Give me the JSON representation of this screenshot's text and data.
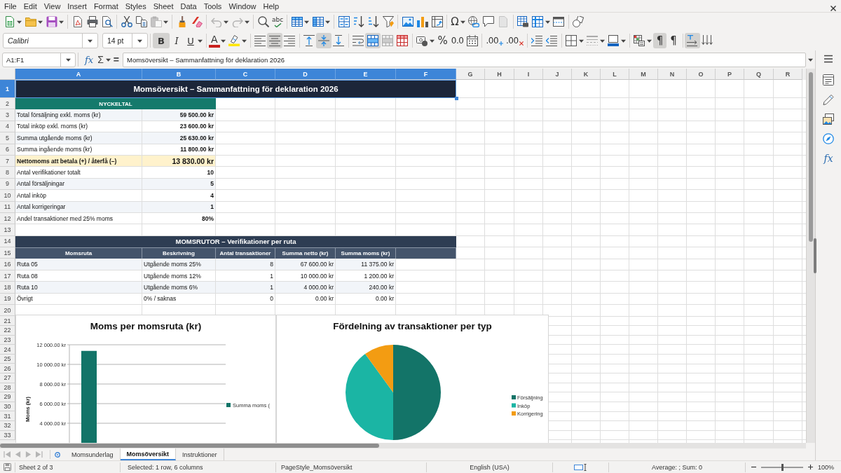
{
  "menu_bar": [
    "File",
    "Edit",
    "View",
    "Insert",
    "Format",
    "Styles",
    "Sheet",
    "Data",
    "Tools",
    "Window",
    "Help"
  ],
  "standard_toolbar": {
    "paste": {
      "disabled": true
    },
    "undo": {
      "disabled": true
    },
    "redo": {
      "disabled": true
    },
    "spelling": {
      "glyph": "abc"
    },
    "special_character": {
      "glyph": "Ω"
    }
  },
  "formatting_toolbar": {
    "font_name": "Calibri",
    "font_size": "14 pt",
    "bold": {
      "glyph": "B",
      "pressed": true
    },
    "italic": {
      "glyph": "I",
      "pressed": false
    },
    "underline": {
      "glyph": "U",
      "pressed": false
    },
    "font_color": {
      "glyph": "A"
    },
    "align_left": {
      "pressed": false
    },
    "align_center": {
      "pressed": true
    },
    "align_right": {
      "pressed": false
    },
    "align_top": {
      "pressed": false
    },
    "align_middle": {
      "pressed": true
    },
    "align_bottom": {
      "pressed": false
    },
    "merge_and_center": {
      "pressed": true
    },
    "percent": {
      "glyph": "%"
    },
    "number": {
      "glyph": "0.0"
    },
    "add_decimal": {
      "glyph": ".00"
    },
    "delete_decimal": {
      "glyph": ".00"
    },
    "left_to_right": {
      "glyph": "¶",
      "pressed": true
    },
    "right_to_left": {
      "glyph": "¶",
      "pressed": false
    },
    "text_direction": {
      "pressed": true
    }
  },
  "formula_bar": {
    "name_box": "A1:F1",
    "function_glyph": "fx",
    "sum_glyph": "Σ",
    "equals_glyph": "=",
    "content": "Momsöversikt – Sammanfattning för deklaration 2026"
  },
  "sidebar": {
    "functions_glyph": "fx"
  },
  "sheet": {
    "columns": [
      {
        "label": "A",
        "selected": true
      },
      {
        "label": "B",
        "selected": true
      },
      {
        "label": "C",
        "selected": true
      },
      {
        "label": "D",
        "selected": true
      },
      {
        "label": "E",
        "selected": true
      },
      {
        "label": "F",
        "selected": true
      },
      {
        "label": "G",
        "selected": false
      },
      {
        "label": "H",
        "selected": false
      },
      {
        "label": "I",
        "selected": false
      },
      {
        "label": "J",
        "selected": false
      },
      {
        "label": "K",
        "selected": false
      },
      {
        "label": "L",
        "selected": false
      },
      {
        "label": "M",
        "selected": false
      },
      {
        "label": "N",
        "selected": false
      },
      {
        "label": "O",
        "selected": false
      },
      {
        "label": "P",
        "selected": false
      },
      {
        "label": "Q",
        "selected": false
      },
      {
        "label": "R",
        "selected": false
      }
    ],
    "rows": [
      {
        "label": "1",
        "selected": true
      },
      {
        "label": "2",
        "selected": false
      },
      {
        "label": "3",
        "selected": false
      },
      {
        "label": "4",
        "selected": false
      },
      {
        "label": "5",
        "selected": false
      },
      {
        "label": "6",
        "selected": false
      },
      {
        "label": "7",
        "selected": false
      },
      {
        "label": "8",
        "selected": false
      },
      {
        "label": "9",
        "selected": false
      },
      {
        "label": "10",
        "selected": false
      },
      {
        "label": "11",
        "selected": false
      },
      {
        "label": "12",
        "selected": false
      },
      {
        "label": "13",
        "selected": false
      },
      {
        "label": "14",
        "selected": false
      },
      {
        "label": "15",
        "selected": false
      },
      {
        "label": "16",
        "selected": false
      },
      {
        "label": "17",
        "selected": false
      },
      {
        "label": "18",
        "selected": false
      },
      {
        "label": "19",
        "selected": false
      },
      {
        "label": "20",
        "selected": false
      },
      {
        "label": "21",
        "selected": false
      },
      {
        "label": "22",
        "selected": false
      },
      {
        "label": "23",
        "selected": false
      },
      {
        "label": "24",
        "selected": false
      },
      {
        "label": "25",
        "selected": false
      },
      {
        "label": "26",
        "selected": false
      },
      {
        "label": "27",
        "selected": false
      },
      {
        "label": "28",
        "selected": false
      },
      {
        "label": "29",
        "selected": false
      },
      {
        "label": "30",
        "selected": false
      },
      {
        "label": "31",
        "selected": false
      },
      {
        "label": "32",
        "selected": false
      },
      {
        "label": "33",
        "selected": false
      }
    ],
    "title": {
      "text": "Momsöversikt – Sammanfattning för deklaration 2026",
      "selected": true
    },
    "key_figures": {
      "heading": "NYCKELTAL",
      "items": [
        {
          "label": "Total försäljning exkl. moms (kr)",
          "value": "59 500.00 kr",
          "highlighted": false
        },
        {
          "label": "Total inköp exkl. moms (kr)",
          "value": "23 600.00 kr",
          "highlighted": false
        },
        {
          "label": "Summa utgående moms (kr)",
          "value": "25 630.00 kr",
          "highlighted": false
        },
        {
          "label": "Summa ingående moms (kr)",
          "value": "11 800.00 kr",
          "highlighted": false
        },
        {
          "label": "Nettomoms att betala (+) / återfå (–)",
          "value": "13 830.00 kr",
          "highlighted": true
        },
        {
          "label": "Antal verifikationer totalt",
          "value": "10",
          "highlighted": false
        },
        {
          "label": "Antal försäljningar",
          "value": "5",
          "highlighted": false
        },
        {
          "label": "Antal inköp",
          "value": "4",
          "highlighted": false
        },
        {
          "label": "Antal korrigeringar",
          "value": "1",
          "highlighted": false
        },
        {
          "label": "Andel transaktioner med 25% moms",
          "value": "80%",
          "highlighted": false
        }
      ]
    },
    "vat_boxes": {
      "heading": "MOMSRUTOR – Verifikationer per ruta",
      "columns": [
        "Momsruta",
        "Beskrivning",
        "Antal transaktioner",
        "Summa netto (kr)",
        "Summa moms (kr)"
      ],
      "rows": [
        [
          "Ruta 05",
          "Utgående moms 25%",
          "8",
          "67 600.00 kr",
          "11 375.00 kr"
        ],
        [
          "Ruta 08",
          "Utgående moms 12%",
          "1",
          "10 000.00 kr",
          "1 200.00 kr"
        ],
        [
          "Ruta 10",
          "Utgående moms 6%",
          "1",
          "4 000.00 kr",
          "240.00 kr"
        ],
        [
          "Övrigt",
          "0% / saknas",
          "0",
          "0.00 kr",
          "0.00 kr"
        ]
      ]
    },
    "charts": [
      {
        "chart_data": {
          "type": "bar",
          "title": "Moms per momsruta (kr)",
          "ylabel": "Moms (kr)",
          "ylim": [
            2000,
            12000
          ],
          "yticks": [
            {
              "value": 12000,
              "label": "12 000.00 kr"
            },
            {
              "value": 10000,
              "label": "10 000.00 kr"
            },
            {
              "value": 8000,
              "label": "8 000.00 kr"
            },
            {
              "value": 6000,
              "label": "6 000.00 kr"
            },
            {
              "value": 4000,
              "label": "4 000.00 kr"
            }
          ],
          "grid": true,
          "legend": "right",
          "series": [
            {
              "name": "Summa moms (",
              "color": "#137468",
              "values": [
                11375
              ]
            }
          ]
        }
      },
      {
        "chart_data": {
          "type": "pie",
          "title": "Fördelning av transaktioner per typ",
          "categories": [
            "Försäljning",
            "Inköp",
            "Korrigering"
          ],
          "values": [
            50,
            40,
            10
          ],
          "legend": "right"
        },
        "slices": [
          {
            "color": "#137468"
          },
          {
            "color": "#1bb5a4"
          },
          {
            "color": "#f39c12"
          }
        ]
      }
    ]
  },
  "sheet_tabs": [
    {
      "label": "Momsunderlag",
      "selected": false
    },
    {
      "label": "Momsöversikt",
      "selected": true
    },
    {
      "label": "Instruktioner",
      "selected": false
    }
  ],
  "status_bar": {
    "sheet_position": "Sheet 2 of 3",
    "selection": "Selected: 1 row, 6 columns",
    "page_style": "PageStyle_Momsöversikt",
    "language": "English (USA)",
    "summary": "Average: ; Sum: 0",
    "zoom": {
      "level": 0.5,
      "reading": "100%"
    }
  }
}
